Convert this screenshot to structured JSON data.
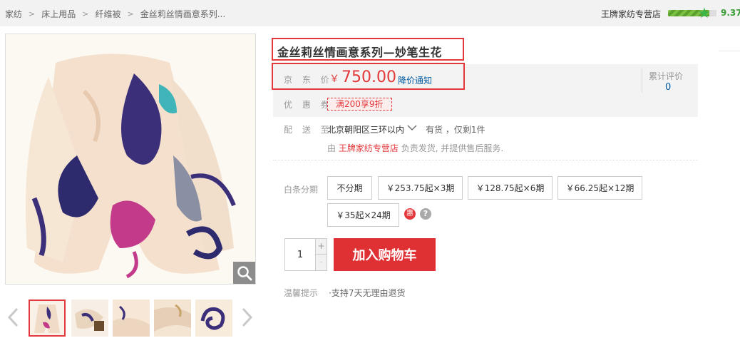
{
  "breadcrumb": [
    "家纺",
    "床上用品",
    "纤维被",
    "金丝莉丝情画意系列..."
  ],
  "shop": {
    "name": "王牌家纺专营店",
    "score": "9.37",
    "score_fraction": 0.937
  },
  "product": {
    "title": "金丝莉丝情画意系列—妙笔生花",
    "price_label": "京 东 价",
    "currency": "￥",
    "price": "750.00",
    "price_notify": "降价通知",
    "reviews_label": "累计评价",
    "reviews_count": "0",
    "coupon_label": "优 惠 券",
    "coupon": "满200享9折"
  },
  "delivery": {
    "label": "配 送 至",
    "address": "北京朝阳区三环以内",
    "stock": "有货 ，仅剩1件",
    "seller_prefix": "由",
    "seller_shop": "王牌家纺专营店",
    "seller_suffix": "负责发货, 并提供售后服务."
  },
  "installment": {
    "label": "白条分期",
    "options": [
      "不分期",
      "￥253.75起×3期",
      "￥128.75起×6期",
      "￥66.25起×12期",
      "￥35起×24期"
    ],
    "hui": "惠",
    "help": "?"
  },
  "purchase": {
    "quantity": "1",
    "plus": "+",
    "minus": "-",
    "add_to_cart": "加入购物车"
  },
  "tips": {
    "label": "温馨提示",
    "text": "·支持7天无理由退货"
  },
  "colors": {
    "accent": "#e4393c",
    "link": "#005aa0",
    "score_green": "#3b9c37"
  },
  "icons": {
    "zoom": "magnifier-icon",
    "prev": "chevron-left-icon",
    "next": "chevron-right-icon",
    "star": "star-icon"
  }
}
